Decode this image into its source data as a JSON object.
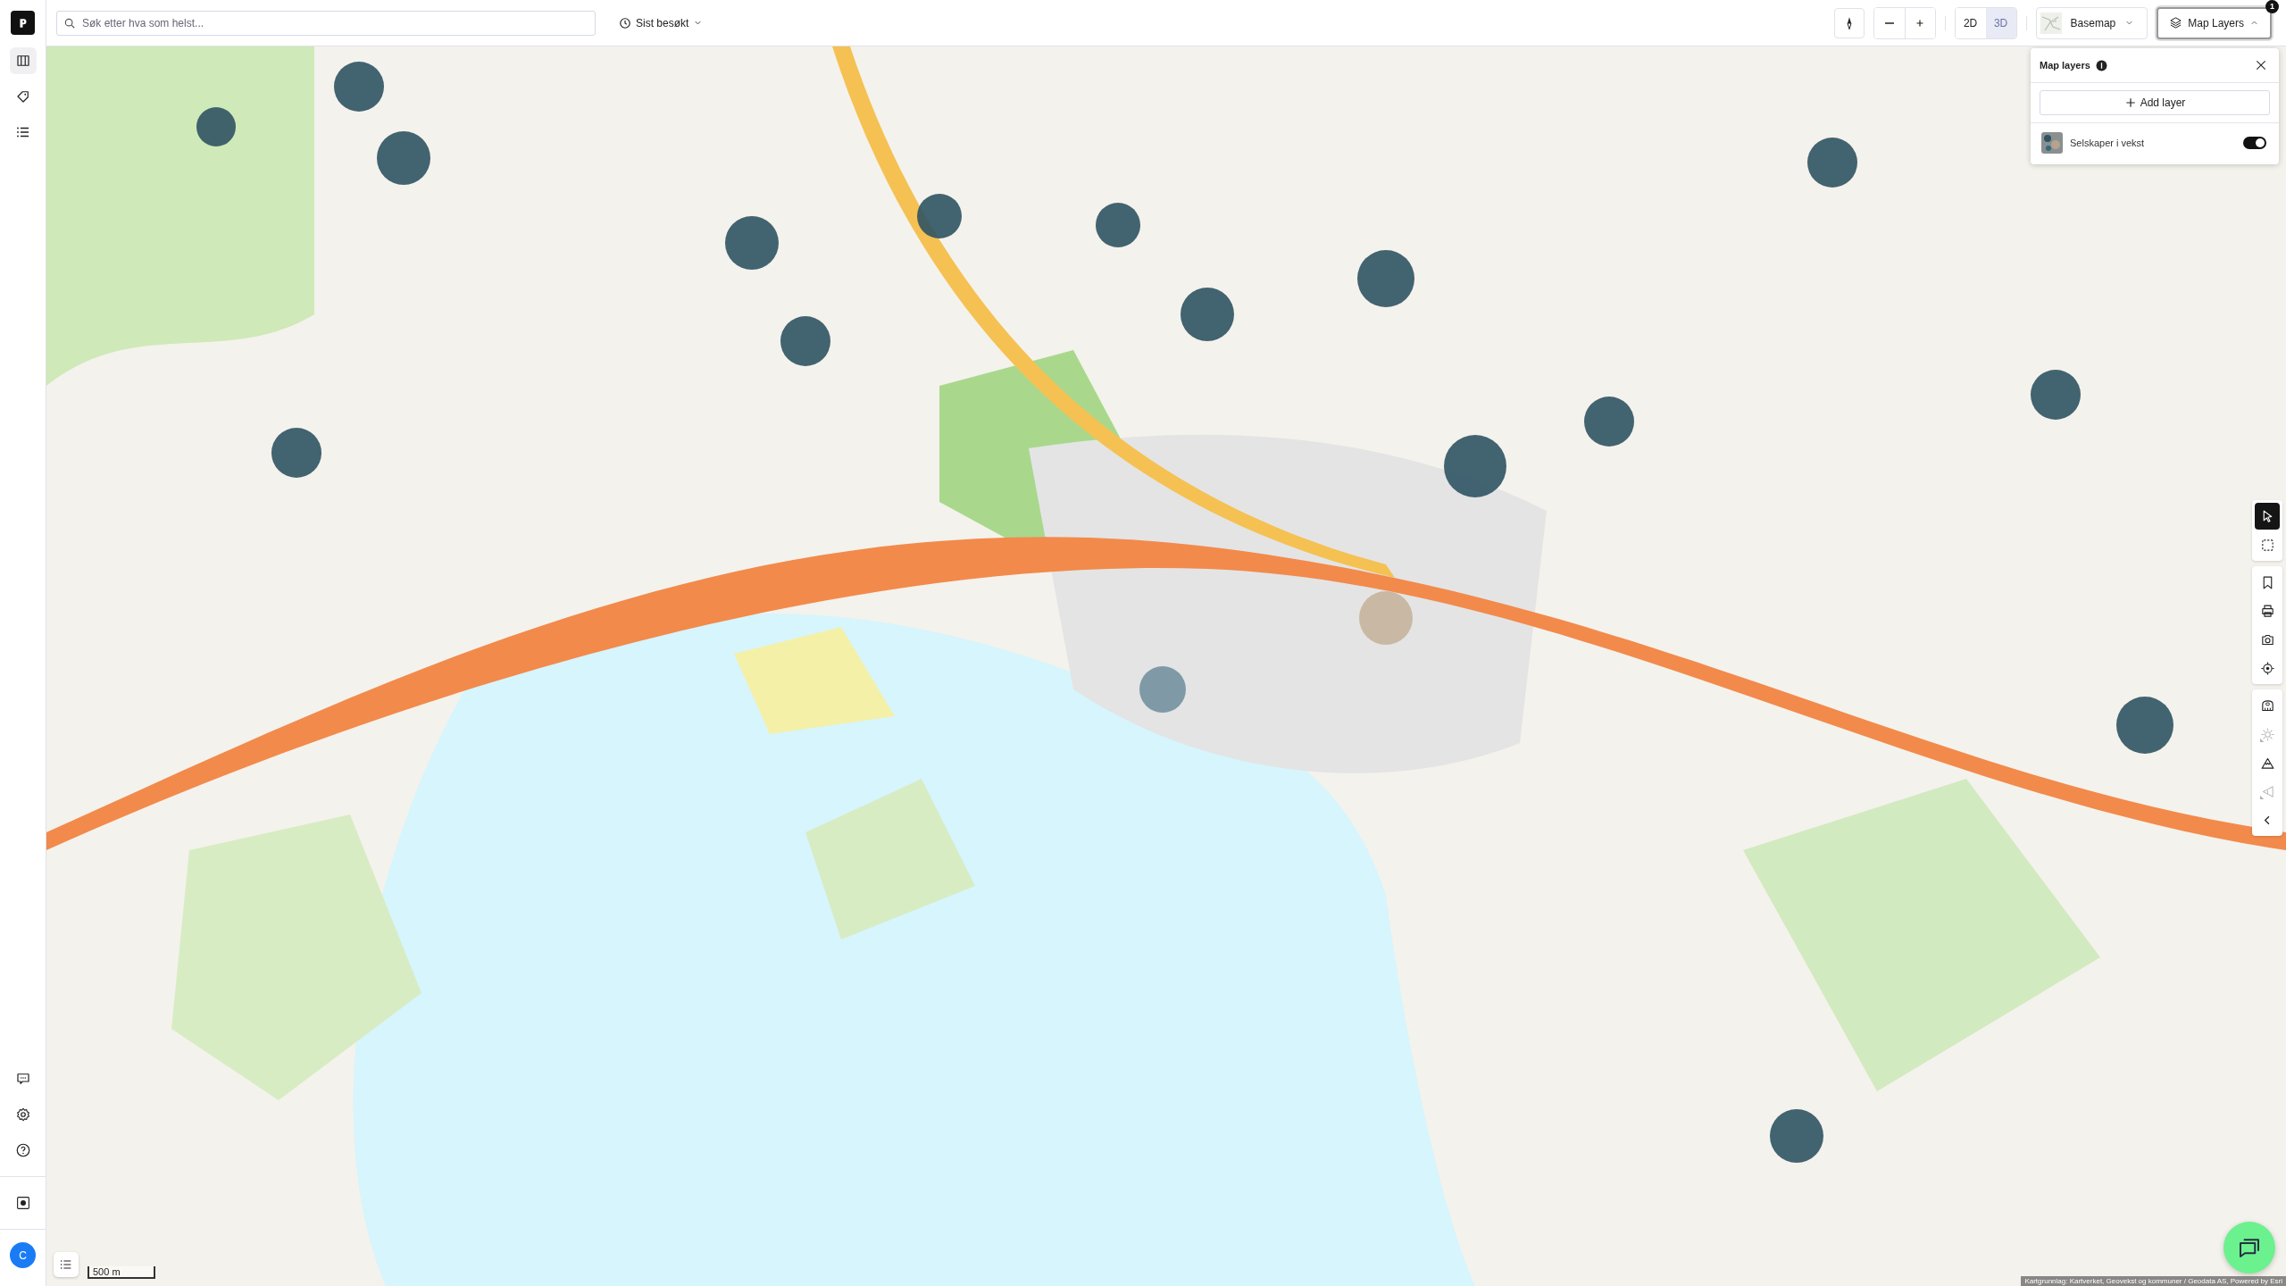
{
  "search": {
    "placeholder": "Søk etter hva som helst..."
  },
  "recent": {
    "label": "Sist besøkt"
  },
  "sidebar": {
    "top_items": [
      {
        "kind": "map",
        "selected": true
      },
      {
        "kind": "tag",
        "selected": false
      },
      {
        "kind": "list",
        "selected": false
      }
    ],
    "bottom_items": [
      {
        "kind": "chat"
      },
      {
        "kind": "settings"
      },
      {
        "kind": "help"
      }
    ],
    "record": {
      "kind": "record"
    },
    "avatar": {
      "initial": "C"
    }
  },
  "view_modes": [
    {
      "label": "2D",
      "selected": false
    },
    {
      "label": "3D",
      "selected": true
    }
  ],
  "basemap": {
    "label": "Basemap"
  },
  "layers_button": {
    "label": "Map Layers",
    "badge": "1",
    "expanded": true
  },
  "layers_panel": {
    "title": "Map layers",
    "add_label": "Add layer",
    "layers": [
      {
        "name": "Selskaper i vekst",
        "on": true
      }
    ]
  },
  "tools": [
    [
      {
        "kind": "select",
        "selected": true,
        "disabled": false
      },
      {
        "kind": "area-select",
        "selected": false,
        "disabled": false
      }
    ],
    [
      {
        "kind": "bookmark",
        "selected": false,
        "disabled": false
      },
      {
        "kind": "print",
        "selected": false,
        "disabled": false
      },
      {
        "kind": "camera",
        "selected": false,
        "disabled": false
      },
      {
        "kind": "locate",
        "selected": false,
        "disabled": false
      }
    ],
    [
      {
        "kind": "measure",
        "selected": false,
        "disabled": false
      },
      {
        "kind": "sun",
        "selected": false,
        "disabled": true
      },
      {
        "kind": "mountain",
        "selected": false,
        "disabled": false
      },
      {
        "kind": "view-angle",
        "selected": false,
        "disabled": true
      },
      {
        "kind": "collapse",
        "selected": false,
        "disabled": false
      }
    ]
  ],
  "scale": {
    "label": "500 m"
  },
  "attribution": "Kartgrunnlag: Kartverket, Geovekst og kommuner / Geodata AS, Powered by Esri"
}
